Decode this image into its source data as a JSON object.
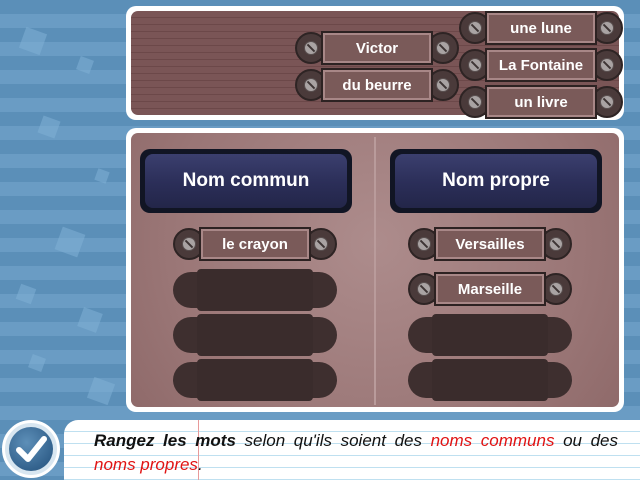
{
  "word_bank": {
    "items": [
      "Victor",
      "du beurre",
      "une lune",
      "La Fontaine",
      "un livre"
    ]
  },
  "columns": [
    {
      "header": "Nom commun",
      "placed": [
        "le crayon"
      ],
      "empty_slots": 3
    },
    {
      "header": "Nom propre",
      "placed": [
        "Versailles",
        "Marseille"
      ],
      "empty_slots": 2
    }
  ],
  "instruction": {
    "part1": "Rangez les mots",
    "part2": " selon qu'ils soient des ",
    "part3": "noms communs",
    "part4": " ou des ",
    "part5": "noms propres",
    "part6": "."
  },
  "icons": {
    "submit": "check-icon",
    "screw": "screw-icon"
  },
  "colors": {
    "accent_red": "#e01414",
    "header_bg": "#2b2e58",
    "tag_bg": "#7a5a59"
  }
}
